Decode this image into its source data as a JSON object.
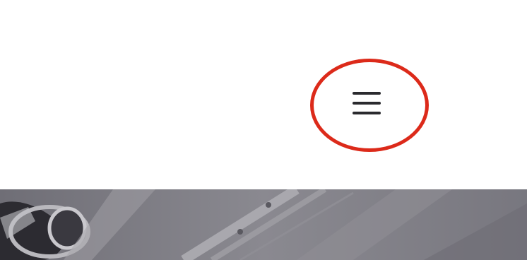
{
  "header": {
    "menu_button": {
      "icon": "hamburger-menu-icon"
    },
    "highlight": {
      "color": "#dc2a1a"
    }
  },
  "hero": {
    "image": "hero-banner-image",
    "tint": "#7d7c84"
  }
}
